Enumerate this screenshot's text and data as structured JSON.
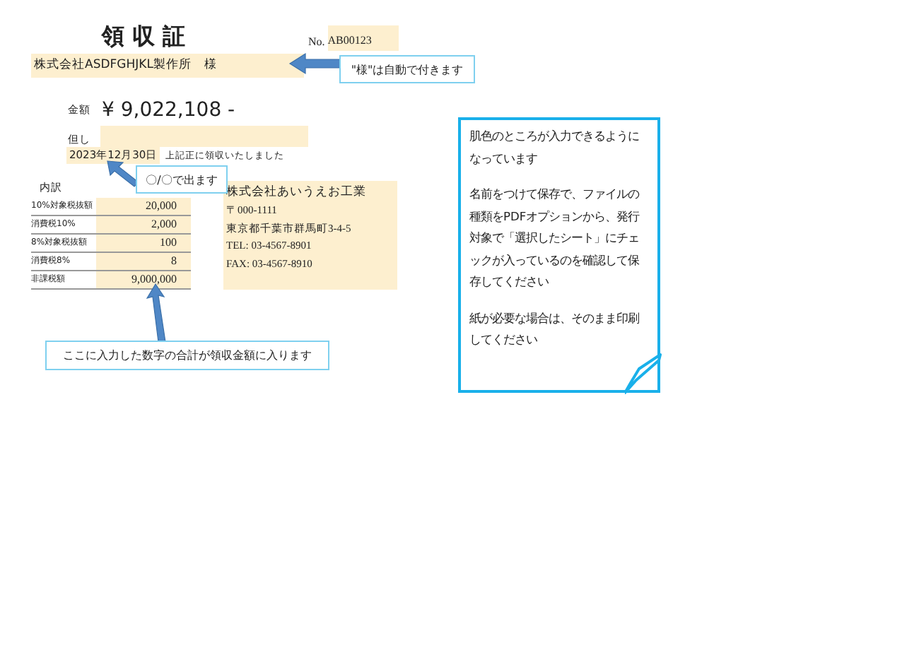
{
  "receipt": {
    "title": "領 収 証",
    "number_label": "No.",
    "number": "AB00123",
    "addressee": "株式会社ASDFGHJKL製作所　様",
    "amount_label": "金額",
    "amount": "¥ 9,022,108 -",
    "proviso_label": "但し",
    "date": "2023年12月30日",
    "received_text": "上記正に領収いたしました",
    "breakdown_label": "内訳",
    "breakdown": [
      {
        "label": "10%対象税抜額",
        "value": "20,000"
      },
      {
        "label": "消費税10%",
        "value": "2,000"
      },
      {
        "label": "8%対象税抜額",
        "value": "100"
      },
      {
        "label": "消費税8%",
        "value": "8"
      },
      {
        "label": "非課税額",
        "value": "9,000,000"
      }
    ],
    "issuer": {
      "name": "株式会社あいうえお工業",
      "lines": [
        "〒000-1111",
        "東京都千葉市群馬町3-4-5",
        "TEL: 03-4567-8901",
        "FAX: 03-4567-8910"
      ]
    }
  },
  "callouts": [
    {
      "text": "\"様\"は自動で付きます"
    },
    {
      "text": "〇/〇で出ます"
    },
    {
      "text": "ここに入力した数字の合計が領収金額に入ります"
    }
  ],
  "note": {
    "paragraphs": [
      "肌色のところが入力できるようになっています",
      "名前をつけて保存で、ファイルの種類をPDFオプションから、発行対象で「選択したシート」にチェックが入っているのを確認して保存してください",
      "紙が必要な場合は、そのまま印刷してください"
    ]
  }
}
